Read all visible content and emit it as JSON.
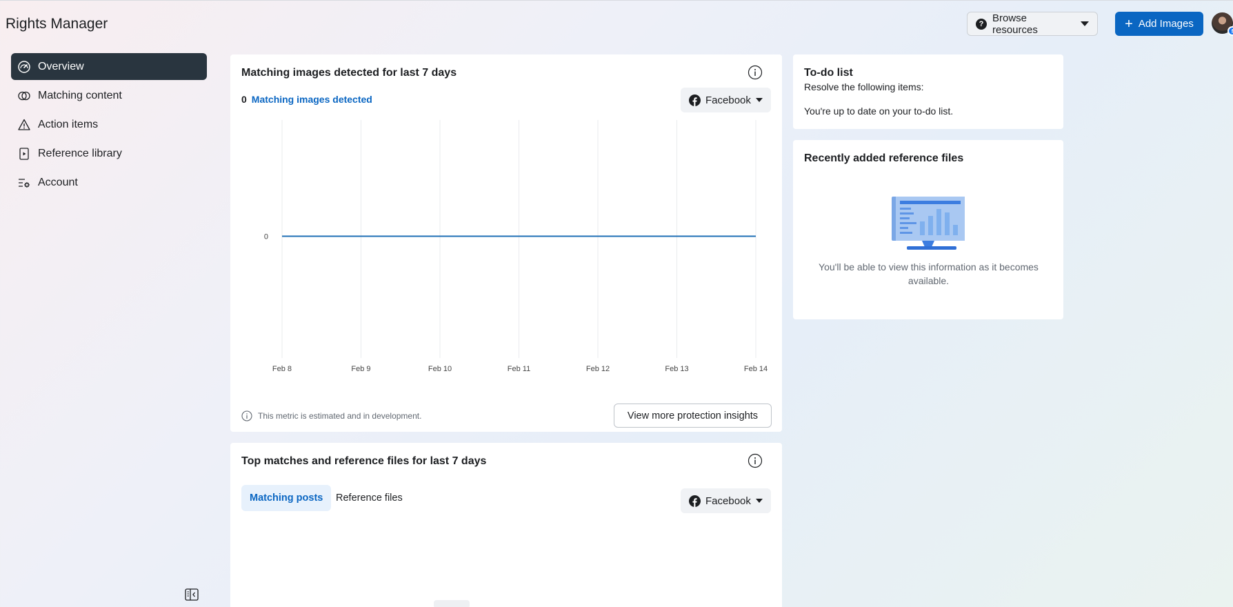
{
  "app": {
    "title": "Rights Manager"
  },
  "header": {
    "browse_label": "Browse resources",
    "add_label": "Add Images"
  },
  "sidebar": {
    "items": [
      {
        "label": "Overview",
        "icon": "gauge-icon",
        "active": true
      },
      {
        "label": "Matching content",
        "icon": "overlap-circles-icon",
        "active": false
      },
      {
        "label": "Action items",
        "icon": "warning-icon",
        "active": false
      },
      {
        "label": "Reference library",
        "icon": "video-file-icon",
        "active": false
      },
      {
        "label": "Account",
        "icon": "settings-list-icon",
        "active": false
      }
    ]
  },
  "matching_card": {
    "title": "Matching images detected for last 7 days",
    "count": "0",
    "count_label": "Matching images detected",
    "platform": "Facebook",
    "note": "This metric is estimated and in development.",
    "insights_button": "View more protection insights"
  },
  "chart_data": {
    "type": "line",
    "title": "",
    "xlabel": "",
    "ylabel": "",
    "categories": [
      "Feb 8",
      "Feb 9",
      "Feb 10",
      "Feb 11",
      "Feb 12",
      "Feb 13",
      "Feb 14"
    ],
    "series": [
      {
        "values": [
          0,
          0,
          0,
          0,
          0,
          0,
          0
        ]
      }
    ],
    "y_ticks": [
      "0"
    ],
    "grid": "vertical",
    "color": "#1f6fb5"
  },
  "top_card": {
    "title": "Top matches and reference files for last 7 days",
    "tabs": [
      "Matching posts",
      "Reference files"
    ],
    "platform": "Facebook"
  },
  "todo": {
    "title": "To-do list",
    "subtitle": "Resolve the following items:",
    "status": "You're up to date on your to-do list."
  },
  "recent": {
    "title": "Recently added reference files",
    "empty_text": "You'll be able to view this information as it becomes available."
  },
  "colors": {
    "accent": "#0a66c2",
    "nav_active": "#29353f"
  }
}
